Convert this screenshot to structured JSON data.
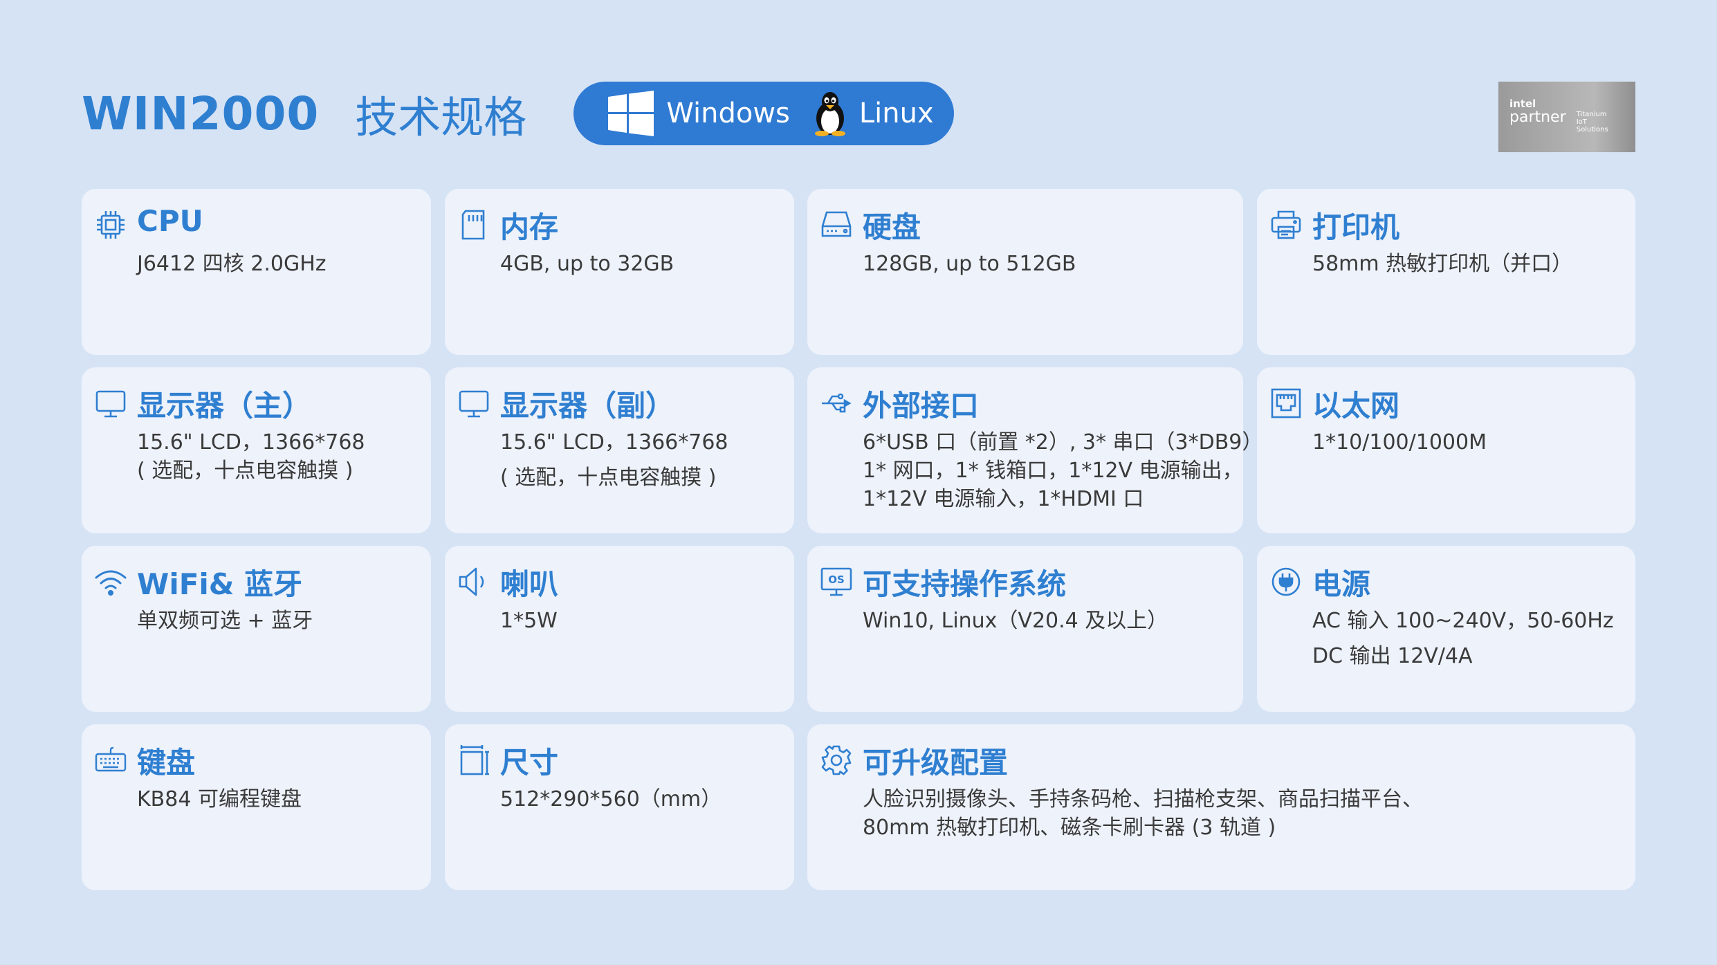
{
  "header": {
    "product": "WIN2000",
    "subtitle": "技术规格",
    "os": [
      "Windows",
      "Linux"
    ]
  },
  "badge": {
    "brand": "intel",
    "program": "partner",
    "tier": [
      "Titanium",
      "IoT",
      "Solutions"
    ]
  },
  "colors": {
    "accent": "#2f7fd1",
    "background": "#d6e3f5",
    "card": "#edf2fb"
  },
  "cards": {
    "cpu": {
      "icon": "chip-icon",
      "title": "CPU",
      "lines": [
        "J6412 四核 2.0GHz"
      ]
    },
    "memory": {
      "icon": "memory-card-icon",
      "title": "内存",
      "lines": [
        "4GB, up to 32GB"
      ]
    },
    "disk": {
      "icon": "hard-drive-icon",
      "title": "硬盘",
      "lines": [
        "128GB, up to 512GB"
      ]
    },
    "printer": {
      "icon": "printer-icon",
      "title": "打印机",
      "lines": [
        "58mm 热敏打印机（并口）"
      ]
    },
    "display_main": {
      "icon": "monitor-icon",
      "title": "显示器（主）",
      "lines": [
        "15.6\" LCD，1366*768",
        "( 选配，十点电容触摸 )"
      ]
    },
    "display_sub": {
      "icon": "monitor-icon",
      "title": "显示器（副）",
      "lines": [
        "15.6\" LCD，1366*768",
        "( 选配，十点电容触摸 )"
      ]
    },
    "ports": {
      "icon": "usb-icon",
      "title": "外部接口",
      "lines": [
        "6*USB 口（前置 *2）, 3* 串口（3*DB9）,",
        "1* 网口，1* 钱箱口，1*12V 电源输出，",
        "1*12V 电源输入，1*HDMI 口"
      ]
    },
    "ethernet": {
      "icon": "ethernet-port-icon",
      "title": "以太网",
      "lines": [
        "1*10/100/1000M"
      ]
    },
    "wifi": {
      "icon": "wifi-icon",
      "title": "WiFi& 蓝牙",
      "lines": [
        "单双频可选 + 蓝牙"
      ]
    },
    "speaker": {
      "icon": "speaker-icon",
      "title": "喇叭",
      "lines": [
        "1*5W"
      ]
    },
    "os": {
      "icon": "os-monitor-icon",
      "title": "可支持操作系统",
      "lines": [
        "Win10, Linux（V20.4 及以上）"
      ]
    },
    "power": {
      "icon": "power-plug-icon",
      "title": "电源",
      "lines": [
        "AC 输入 100~240V，50-60Hz",
        "DC 输出 12V/4A"
      ]
    },
    "keyboard": {
      "icon": "keyboard-icon",
      "title": "键盘",
      "lines": [
        "KB84 可编程键盘"
      ]
    },
    "size": {
      "icon": "dimensions-icon",
      "title": "尺寸",
      "lines": [
        "512*290*560（mm）"
      ]
    },
    "upgrade": {
      "icon": "gear-icon",
      "title": "可升级配置",
      "lines": [
        "人脸识别摄像头、手持条码枪、扫描枪支架、商品扫描平台、",
        "80mm 热敏打印机、磁条卡刷卡器 (3 轨道 )"
      ]
    }
  }
}
